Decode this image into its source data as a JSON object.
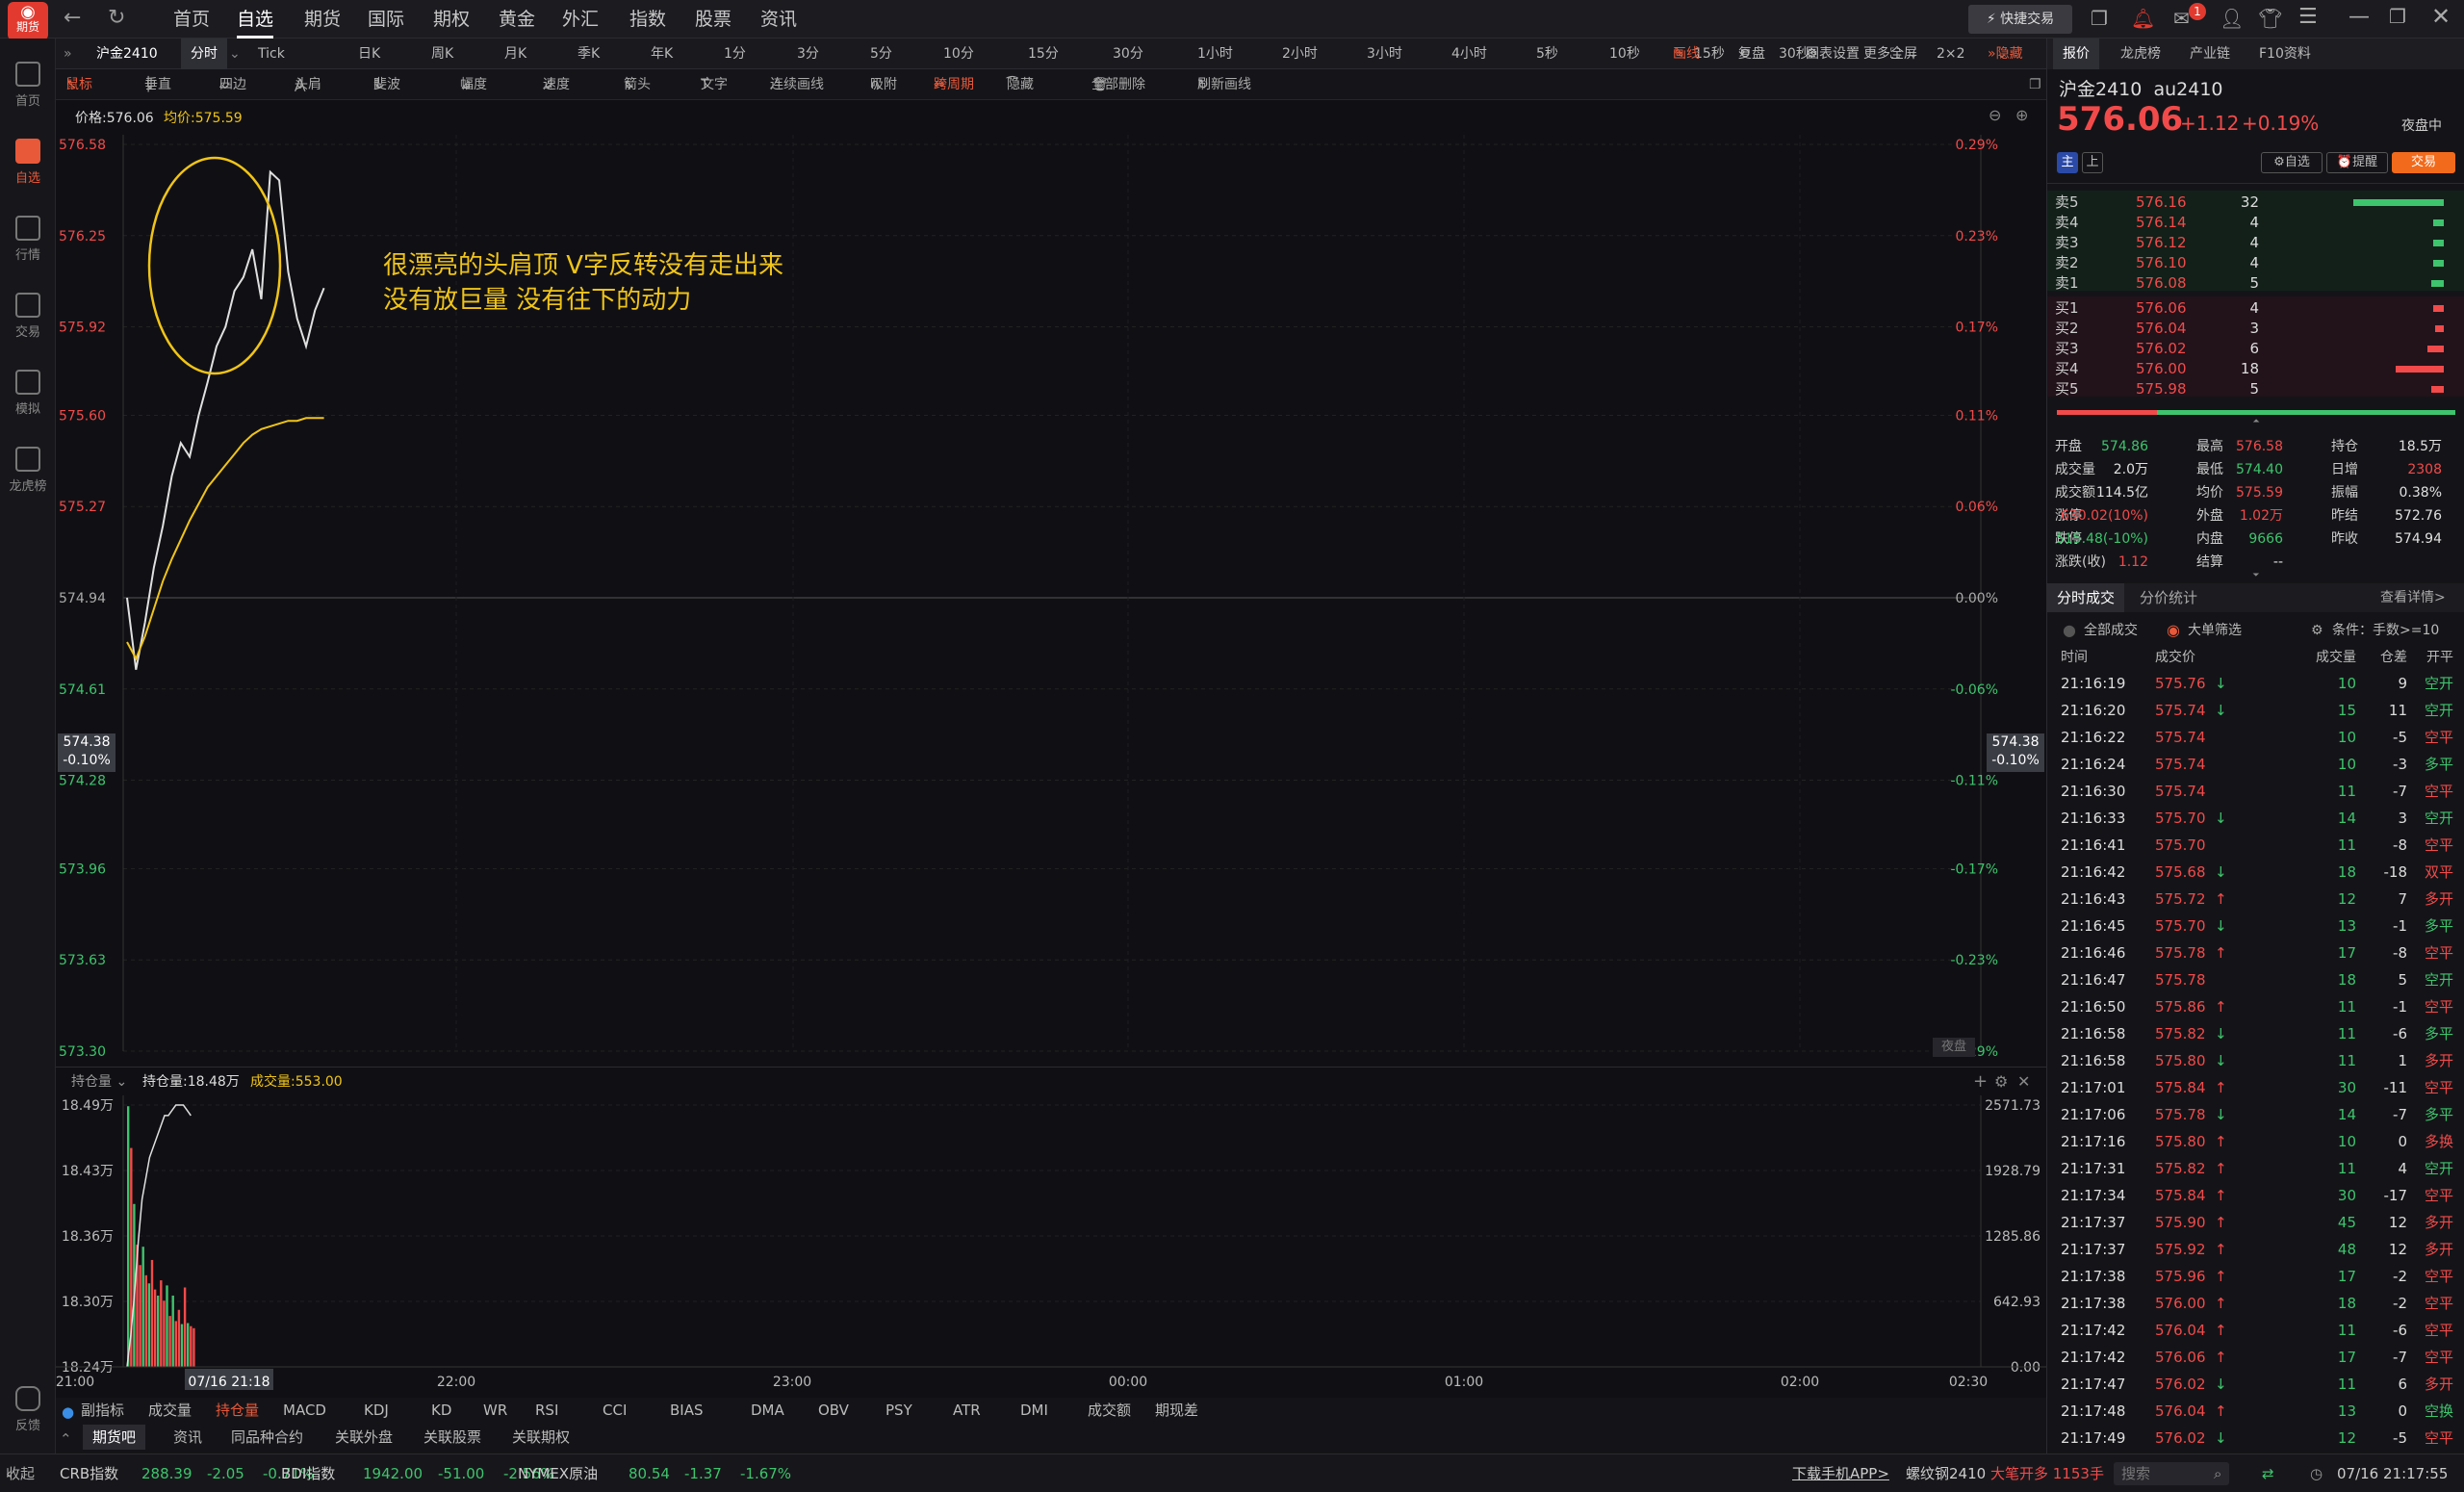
{
  "topbar": {
    "logo_label": "期货",
    "nav": [
      "首页",
      "自选",
      "期货",
      "国际",
      "期权",
      "黄金",
      "外汇",
      "指数",
      "股票",
      "资讯"
    ],
    "active_nav": "自选",
    "quick_trade": "快捷交易",
    "notif_count": "1"
  },
  "sidebar": {
    "items": [
      "首页",
      "自选",
      "行情",
      "交易",
      "模拟",
      "龙虎榜"
    ],
    "feedback": "反馈"
  },
  "toolbar": {
    "symbol": "沪金2410",
    "periods": [
      "分时",
      "Tick",
      "日K",
      "周K",
      "月K",
      "季K",
      "年K",
      "1分",
      "3分",
      "5分",
      "10分",
      "15分",
      "30分",
      "1小时",
      "2小时",
      "3小时",
      "4小时",
      "5秒",
      "10秒",
      "15秒",
      "30秒",
      "更多",
      "2×2"
    ],
    "active_period": "分时",
    "right": [
      "画线",
      "复盘",
      "图表设置",
      "全屏"
    ],
    "hide": "隐藏",
    "accent": "#e8593a"
  },
  "drawbar": {
    "items": [
      "鼠标",
      "垂直",
      "四边",
      "头肩",
      "斐波",
      "幅度",
      "速度",
      "箭头",
      "文字",
      "连续画线",
      "吸附",
      "跨周期",
      "隐藏",
      "全部删除",
      "刷新画线"
    ]
  },
  "chart_header": {
    "price_label": "价格:576.06",
    "avg_label": "均价:575.59"
  },
  "annotation": {
    "line1": "很漂亮的头肩顶 V字反转没有走出来",
    "line2": "没有放巨量 没有往下的动力",
    "color": "#f0c419"
  },
  "night_badge": "夜盘",
  "cursor_left": {
    "price": "574.38",
    "pct": "-0.10%"
  },
  "cursor_right": {
    "price": "574.38",
    "pct": "-0.10%"
  },
  "lower_header": {
    "indicator": "持仓量",
    "oi_label": "持仓量:18.48万",
    "vol_label": "成交量:553.00"
  },
  "chart_data": {
    "type": "line",
    "price_axis": [
      "576.58",
      "576.25",
      "575.92",
      "575.60",
      "575.27",
      "574.94",
      "574.61",
      "574.28",
      "573.96",
      "573.63",
      "573.30"
    ],
    "pct_axis": [
      "0.29%",
      "0.23%",
      "0.17%",
      "0.11%",
      "0.06%",
      "0.00%",
      "-0.06%",
      "-0.11%",
      "-0.17%",
      "-0.23%",
      "-0.29%"
    ],
    "ylim": [
      573.3,
      576.58
    ],
    "time_axis": [
      "21:00",
      "07/16 21:18",
      "22:00",
      "23:00",
      "00:00",
      "01:00",
      "02:00",
      "02:30"
    ],
    "series": [
      {
        "name": "价格",
        "color": "#e0e0e0",
        "values": [
          574.94,
          574.68,
          574.85,
          575.05,
          575.2,
          575.38,
          575.5,
          575.45,
          575.6,
          575.72,
          575.85,
          575.92,
          576.05,
          576.1,
          576.2,
          576.02,
          576.48,
          576.45,
          576.12,
          575.95,
          575.85,
          575.98,
          576.06
        ]
      },
      {
        "name": "均价",
        "color": "#f0c419",
        "values": [
          574.78,
          574.72,
          574.8,
          574.9,
          575.0,
          575.08,
          575.15,
          575.22,
          575.28,
          575.34,
          575.38,
          575.42,
          575.46,
          575.5,
          575.53,
          575.55,
          575.56,
          575.57,
          575.58,
          575.58,
          575.59,
          575.59,
          575.59
        ]
      }
    ],
    "oi_axis": [
      "18.49万",
      "18.43万",
      "18.36万",
      "18.30万",
      "18.24万"
    ],
    "oi_ylim": [
      18.24,
      18.49
    ],
    "vol_axis": [
      "2571.73",
      "1928.79",
      "1285.86",
      "642.93",
      "0.00"
    ],
    "vol_ylim": [
      0,
      2571.73
    ],
    "oi_values": [
      18.24,
      18.27,
      18.31,
      18.36,
      18.4,
      18.42,
      18.44,
      18.45,
      18.46,
      18.47,
      18.48,
      18.48,
      18.485,
      18.49,
      18.49,
      18.49,
      18.485,
      18.48
    ],
    "volumes": [
      2560,
      2150,
      1600,
      1200,
      1000,
      1180,
      900,
      820,
      1050,
      760,
      700,
      850,
      650,
      800,
      500,
      700,
      450,
      560,
      420,
      780,
      430,
      400,
      380
    ],
    "volume_colors": [
      "g",
      "r",
      "g",
      "r",
      "r",
      "g",
      "r",
      "g",
      "r",
      "r",
      "g",
      "r",
      "r",
      "g",
      "r",
      "g",
      "r",
      "r",
      "g",
      "r",
      "g",
      "r",
      "r"
    ]
  },
  "quote": {
    "tabs": [
      "报价",
      "龙虎榜",
      "产业链",
      "F10资料"
    ],
    "name": "沪金2410",
    "code": "au2410",
    "price": "576.06",
    "change": "+1.12",
    "pct": "+0.19%",
    "session": "夜盘中",
    "tag1": "主",
    "tag2": "上",
    "btn_fav": "自选",
    "btn_alert": "提醒",
    "btn_trade": "交易",
    "asks": [
      {
        "label": "卖5",
        "price": "576.16",
        "qty": "32",
        "bar": 0.85
      },
      {
        "label": "卖4",
        "price": "576.14",
        "qty": "4",
        "bar": 0.1
      },
      {
        "label": "卖3",
        "price": "576.12",
        "qty": "4",
        "bar": 0.1
      },
      {
        "label": "卖2",
        "price": "576.10",
        "qty": "4",
        "bar": 0.1
      },
      {
        "label": "卖1",
        "price": "576.08",
        "qty": "5",
        "bar": 0.12
      }
    ],
    "bids": [
      {
        "label": "买1",
        "price": "576.06",
        "qty": "4",
        "bar": 0.1
      },
      {
        "label": "买2",
        "price": "576.04",
        "qty": "3",
        "bar": 0.08
      },
      {
        "label": "买3",
        "price": "576.02",
        "qty": "6",
        "bar": 0.15
      },
      {
        "label": "买4",
        "price": "576.00",
        "qty": "18",
        "bar": 0.45
      },
      {
        "label": "买5",
        "price": "575.98",
        "qty": "5",
        "bar": 0.12
      }
    ],
    "stats": [
      [
        [
          "开盘",
          "574.86",
          "green"
        ],
        [
          "最高",
          "576.58",
          "red"
        ],
        [
          "持仓",
          "18.5万",
          "wht"
        ]
      ],
      [
        [
          "成交量",
          "2.0万",
          "wht"
        ],
        [
          "最低",
          "574.40",
          "green"
        ],
        [
          "日增",
          "2308",
          "red"
        ]
      ],
      [
        [
          "成交额",
          "114.5亿",
          "wht"
        ],
        [
          "均价",
          "575.59",
          "red"
        ],
        [
          "振幅",
          "0.38%",
          "wht"
        ]
      ],
      [
        [
          "涨停",
          "630.02(10%)",
          "red"
        ],
        [
          "外盘",
          "1.02万",
          "red"
        ],
        [
          "昨结",
          "572.76",
          "wht"
        ]
      ],
      [
        [
          "跌停",
          "515.48(-10%)",
          "green"
        ],
        [
          "内盘",
          "9666",
          "green"
        ],
        [
          "昨收",
          "574.94",
          "wht"
        ]
      ],
      [
        [
          "涨跌(收)",
          "1.12",
          "red"
        ],
        [
          "结算",
          "--",
          "wht"
        ],
        [
          "",
          "",
          "wht"
        ]
      ]
    ]
  },
  "trades": {
    "tabs": [
      "分时成交",
      "分价统计"
    ],
    "detail_link": "查看详情>",
    "filter_all": "全部成交",
    "filter_big": "大单筛选",
    "condition": "条件：手数>=10",
    "headers": [
      "时间",
      "成交价",
      "成交量",
      "仓差",
      "开平"
    ],
    "rows": [
      [
        "21:16:19",
        "575.76",
        "↓",
        "10",
        "9",
        "空开",
        "g"
      ],
      [
        "21:16:20",
        "575.74",
        "↓",
        "15",
        "11",
        "空开",
        "g"
      ],
      [
        "21:16:22",
        "575.74",
        "",
        "10",
        "-5",
        "空平",
        "r"
      ],
      [
        "21:16:24",
        "575.74",
        "",
        "10",
        "-3",
        "多平",
        "g"
      ],
      [
        "21:16:30",
        "575.74",
        "",
        "11",
        "-7",
        "空平",
        "r"
      ],
      [
        "21:16:33",
        "575.70",
        "↓",
        "14",
        "3",
        "空开",
        "g"
      ],
      [
        "21:16:41",
        "575.70",
        "",
        "11",
        "-8",
        "空平",
        "r"
      ],
      [
        "21:16:42",
        "575.68",
        "↓",
        "18",
        "-18",
        "双平",
        "r"
      ],
      [
        "21:16:43",
        "575.72",
        "↑",
        "12",
        "7",
        "多开",
        "r"
      ],
      [
        "21:16:45",
        "575.70",
        "↓",
        "13",
        "-1",
        "多平",
        "g"
      ],
      [
        "21:16:46",
        "575.78",
        "↑",
        "17",
        "-8",
        "空平",
        "r"
      ],
      [
        "21:16:47",
        "575.78",
        "",
        "18",
        "5",
        "空开",
        "g"
      ],
      [
        "21:16:50",
        "575.86",
        "↑",
        "11",
        "-1",
        "空平",
        "r"
      ],
      [
        "21:16:58",
        "575.82",
        "↓",
        "11",
        "-6",
        "多平",
        "g"
      ],
      [
        "21:16:58",
        "575.80",
        "↓",
        "11",
        "1",
        "多开",
        "r"
      ],
      [
        "21:17:01",
        "575.84",
        "↑",
        "30",
        "-11",
        "空平",
        "r"
      ],
      [
        "21:17:06",
        "575.78",
        "↓",
        "14",
        "-7",
        "多平",
        "g"
      ],
      [
        "21:17:16",
        "575.80",
        "↑",
        "10",
        "0",
        "多换",
        "r"
      ],
      [
        "21:17:31",
        "575.82",
        "↑",
        "11",
        "4",
        "空开",
        "g"
      ],
      [
        "21:17:34",
        "575.84",
        "↑",
        "30",
        "-17",
        "空平",
        "r"
      ],
      [
        "21:17:37",
        "575.90",
        "↑",
        "45",
        "12",
        "多开",
        "r"
      ],
      [
        "21:17:37",
        "575.92",
        "↑",
        "48",
        "12",
        "多开",
        "r"
      ],
      [
        "21:17:38",
        "575.96",
        "↑",
        "17",
        "-2",
        "空平",
        "r"
      ],
      [
        "21:17:38",
        "576.00",
        "↑",
        "18",
        "-2",
        "空平",
        "r"
      ],
      [
        "21:17:42",
        "576.04",
        "↑",
        "11",
        "-6",
        "空平",
        "r"
      ],
      [
        "21:17:42",
        "576.06",
        "↑",
        "17",
        "-7",
        "空平",
        "r"
      ],
      [
        "21:17:47",
        "576.02",
        "↓",
        "11",
        "6",
        "多开",
        "r"
      ],
      [
        "21:17:48",
        "576.04",
        "↑",
        "13",
        "0",
        "空换",
        "g"
      ],
      [
        "21:17:49",
        "576.02",
        "↓",
        "12",
        "-5",
        "空平",
        "r"
      ]
    ]
  },
  "bottom": {
    "row1": [
      "副指标",
      "成交量",
      "持仓量",
      "MACD",
      "KDJ",
      "KD",
      "WR",
      "RSI",
      "CCI",
      "BIAS",
      "DMA",
      "OBV",
      "PSY",
      "ATR",
      "DMI",
      "成交额",
      "期现差"
    ],
    "active_indicator": "持仓量",
    "row2": [
      "期货吧",
      "资讯",
      "同品种合约",
      "关联外盘",
      "关联股票",
      "关联期权"
    ]
  },
  "statusbar": {
    "collapse": "收起",
    "items": [
      {
        "name": "CRB指数",
        "value": "288.39",
        "chg": "-2.05",
        "pct": "-0.71%"
      },
      {
        "name": "BDI指数",
        "value": "1942.00",
        "chg": "-51.00",
        "pct": "-2.56%"
      },
      {
        "name": "NYMEX原油",
        "value": "80.54",
        "chg": "-1.37",
        "pct": "-1.67%"
      }
    ],
    "download": "下载手机APP>",
    "alert_name": "螺纹钢2410",
    "alert_text": "大笔开多 1153手",
    "search_placeholder": "搜索",
    "datetime": "07/16 21:17:55"
  }
}
